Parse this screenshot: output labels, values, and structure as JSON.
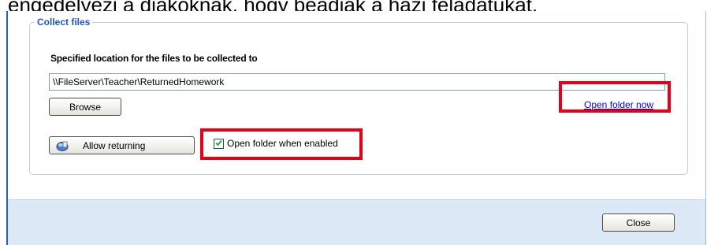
{
  "caption": "engedélyezi a diákoknak, hogy beadják a házi feladatukat.",
  "group_title": "Collect files",
  "location_label": "Specified location for the files to be collected to",
  "path_value": "\\\\FileServer\\Teacher\\ReturnedHomework",
  "browse_label": "Browse",
  "open_folder_now": "Open folder now",
  "allow_returning_label": "Allow returning",
  "open_when_enabled_label": "Open folder when enabled",
  "open_when_enabled_checked": true,
  "close_label": "Close",
  "icons": {
    "allow_returning": "homework-return-icon",
    "checkbox": "checkmark-icon"
  },
  "colors": {
    "highlight": "#e3001b",
    "group_title": "#1f56c2",
    "footer": "#dce8f6",
    "link": "#0000ee"
  }
}
